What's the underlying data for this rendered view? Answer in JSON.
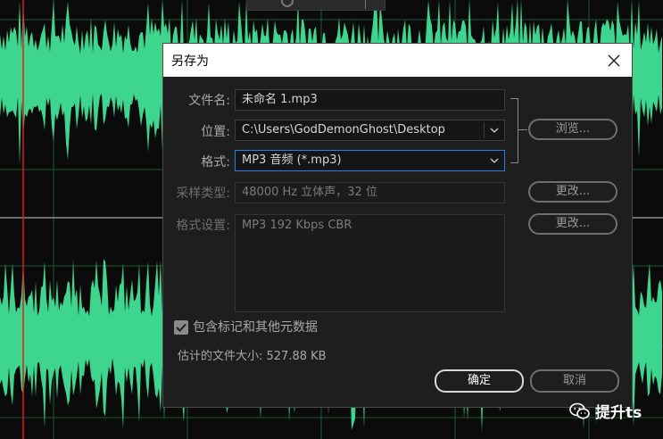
{
  "colors": {
    "waveform": "#3ed68f",
    "playhead": "#e11b1b",
    "grid": "#1f5a37",
    "focus_border": "#2680eb"
  },
  "dialog": {
    "title": "另存为",
    "close_icon": "close-icon",
    "filename": {
      "label": "文件名:",
      "value": "未命名 1.mp3"
    },
    "location": {
      "label": "位置:",
      "value": "C:\\Users\\GodDemonGhost\\Desktop"
    },
    "format": {
      "label": "格式:",
      "value": "MP3 音频 (*.mp3)"
    },
    "sample_type": {
      "label": "采样类型:",
      "value": "48000 Hz 立体声，32 位"
    },
    "format_settings": {
      "label": "格式设置:",
      "value": "MP3 192 Kbps CBR"
    },
    "browse_button": "浏览...",
    "change_button_1": "更改...",
    "change_button_2": "更改...",
    "include_markers": {
      "label": "包含标记和其他元数据",
      "checked": true
    },
    "estimated_size": "估计的文件大小: 527.88 KB",
    "ok_button": "确定",
    "cancel_button": "取消"
  },
  "watermark": {
    "text": "提升ts",
    "icon": "wechat-icon"
  }
}
